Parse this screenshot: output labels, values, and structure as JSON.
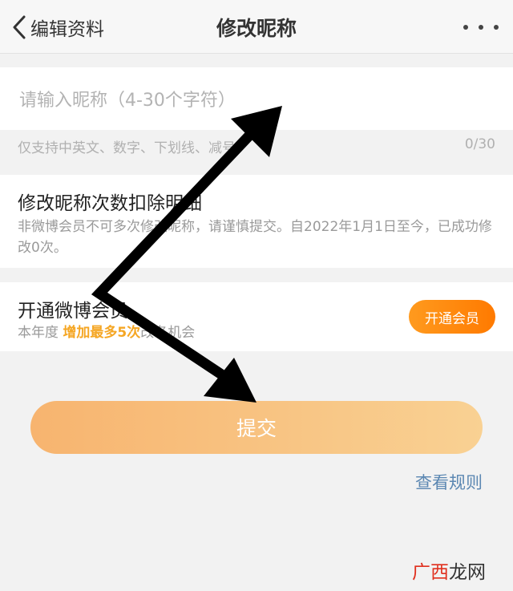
{
  "header": {
    "back_label": "编辑资料",
    "title": "修改昵称"
  },
  "input": {
    "placeholder": "请输入昵称（4-30个字符）",
    "value": "",
    "hint": "仅支持中英文、数字、下划线、减号",
    "counter": "0/30"
  },
  "deduct": {
    "title": "修改昵称次数扣除明细",
    "description": "非微博会员不可多次修改昵称，请谨慎提交。自2022年1月1日至今，已成功修改0次。"
  },
  "vip": {
    "title": "开通微博会员",
    "desc_prefix": "本年度",
    "desc_highlight": "增加最多5次",
    "desc_suffix": "改名机会",
    "button_label": "开通会员"
  },
  "submit_label": "提交",
  "rules_link": "查看规则",
  "watermark": {
    "part1": "广西",
    "part2": "龙网"
  },
  "colors": {
    "accent_orange": "#ff8a00",
    "highlight": "#f5a623",
    "link_blue": "#5b87b2"
  }
}
